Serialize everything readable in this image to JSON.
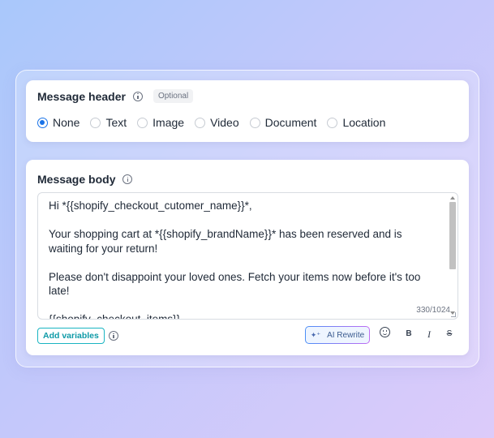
{
  "header_card": {
    "title": "Message header",
    "badge": "Optional",
    "options": [
      {
        "label": "None",
        "checked": true
      },
      {
        "label": "Text",
        "checked": false
      },
      {
        "label": "Image",
        "checked": false
      },
      {
        "label": "Video",
        "checked": false
      },
      {
        "label": "Document",
        "checked": false
      },
      {
        "label": "Location",
        "checked": false
      }
    ]
  },
  "body_card": {
    "title": "Message body",
    "lines": [
      "Hi *{{shopify_checkout_cutomer_name}}*,",
      "",
      "Your shopping cart at *{{shopify_brandName}}* has been reserved and is waiting for your return!",
      "",
      "Please don't disappoint your loved ones. Fetch your items now before it's too late!",
      "",
      "{{shopify_checkout_items}}"
    ],
    "counter": "330/1024"
  },
  "toolbar": {
    "add_variables": "Add variables",
    "ai_rewrite": "AI Rewrite",
    "ai_icon": "sparkle-icon",
    "bold": "B",
    "italic": "I",
    "strike": "S"
  },
  "colors": {
    "accent_blue": "#1a73e8",
    "teal": "#1ab5c2"
  }
}
